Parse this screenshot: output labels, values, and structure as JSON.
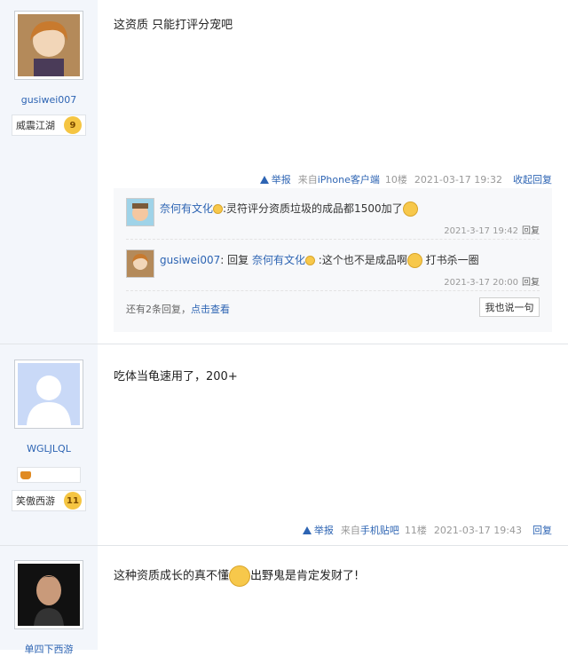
{
  "posts": [
    {
      "username": "gusiwei007",
      "badge_name": "威震江湖",
      "badge_level": "9",
      "content": "这资质 只能打评分宠吧",
      "tail": {
        "report": "举报",
        "source_prefix": "来自",
        "source": "iPhone客户端",
        "floor": "10楼",
        "date": "2021-03-17 19:32",
        "fold": "收起回复"
      },
      "replies": [
        {
          "user": "奈何有文化",
          "text": ":灵符评分资质垃圾的成品都1500加了",
          "date": "2021-3-17 19:42",
          "reply": "回复"
        },
        {
          "user": "gusiwei007",
          "prefix": ": 回复",
          "mention": "奈何有文化",
          "text": ":这个也不是成品啊",
          "text2": "打书杀一圈",
          "date": "2021-3-17 20:00",
          "reply": "回复"
        }
      ],
      "more_text": "还有2条回复，",
      "more_link": "点击查看",
      "say_button": "我也说一句"
    },
    {
      "username": "WGLJLQL",
      "badge_name": "笑傲西游",
      "badge_level": "11",
      "content": "吃体当龟速用了，200+",
      "tail": {
        "report": "举报",
        "source_prefix": "来自",
        "source": "手机贴吧",
        "floor": "11楼",
        "date": "2021-03-17 19:43",
        "reply": "回复"
      }
    },
    {
      "username": "单四下西游",
      "content_a": "这种资质成长的真不懂",
      "content_b": "出野鬼是肯定发财了!"
    }
  ]
}
